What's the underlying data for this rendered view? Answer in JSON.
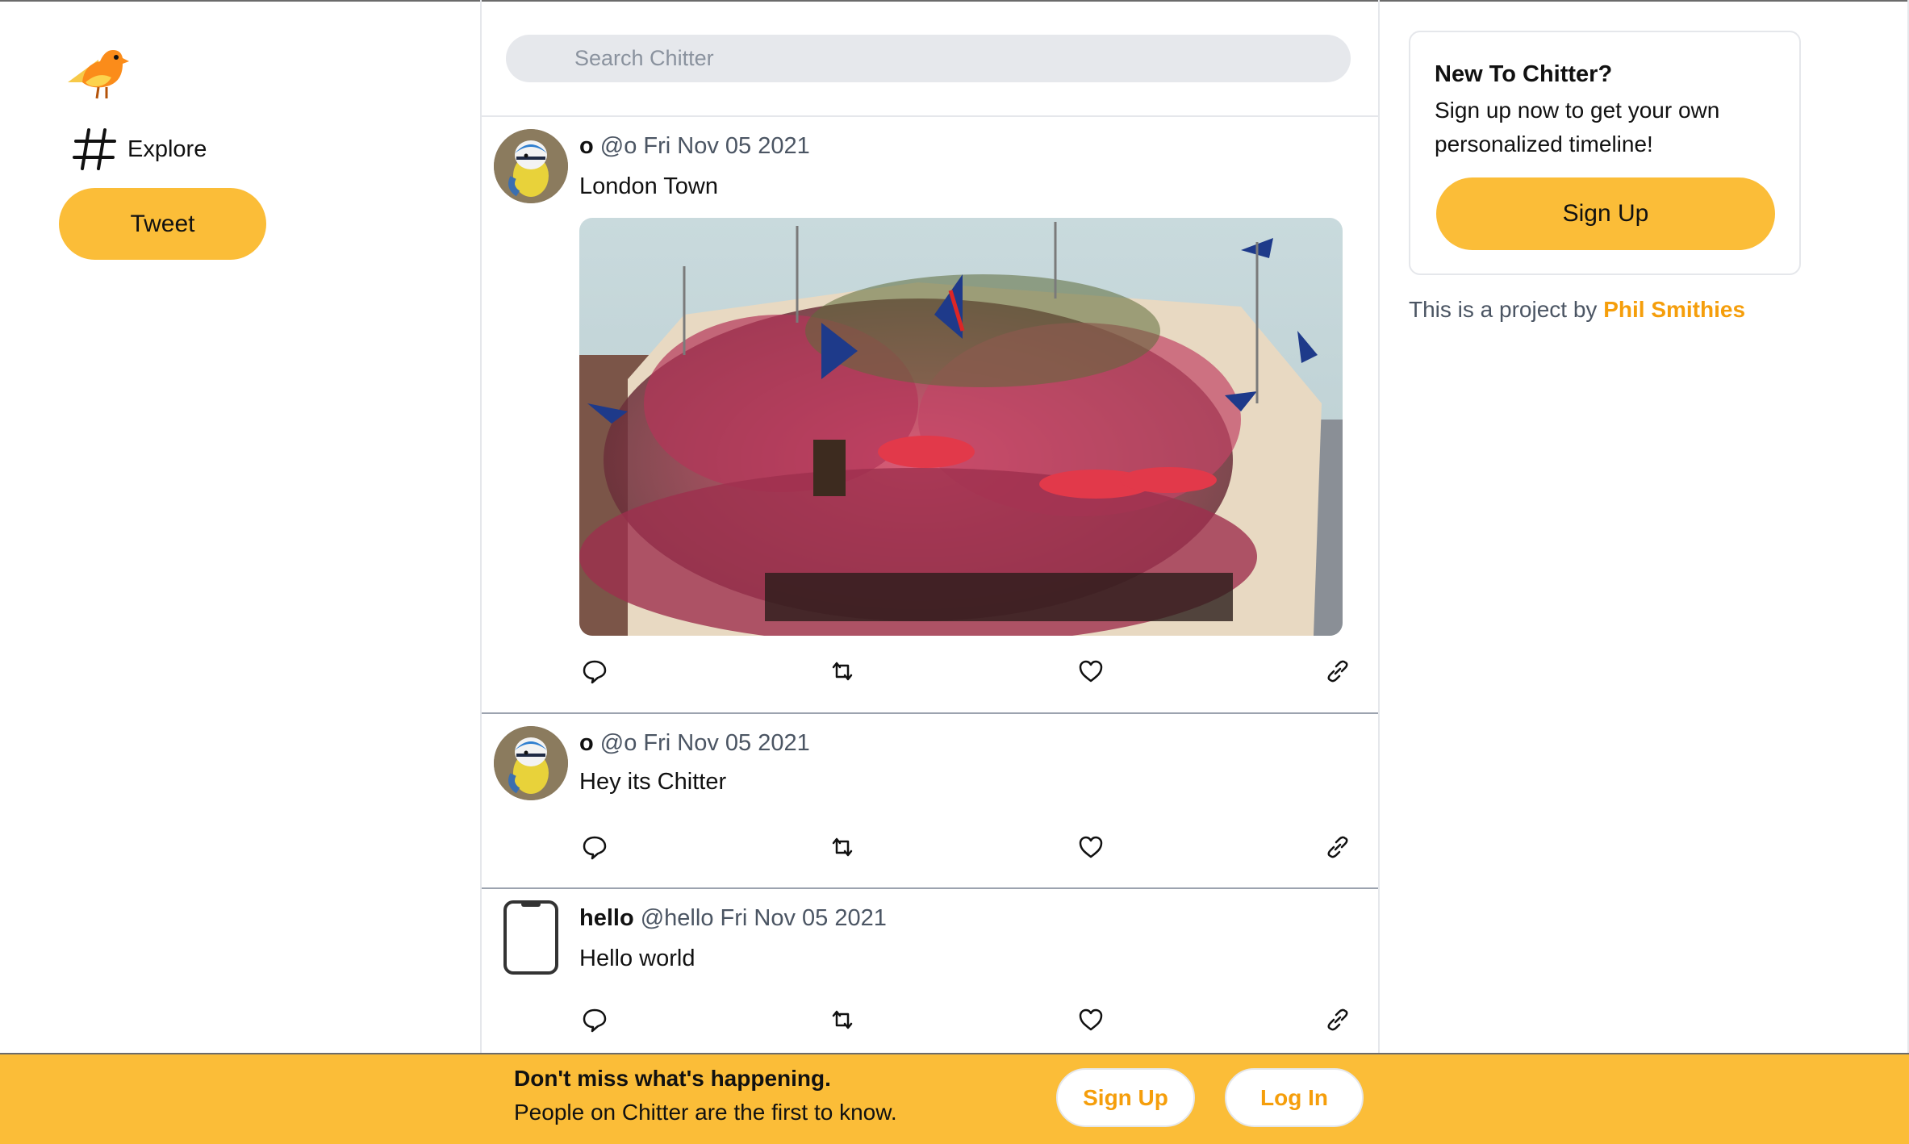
{
  "app": {
    "name": "Chitter"
  },
  "sidebar": {
    "logo_icon": "bird-logo-icon",
    "explore_label": "Explore",
    "explore_icon": "hash-icon",
    "tweet_label": "Tweet"
  },
  "search": {
    "placeholder": "Search Chitter",
    "value": ""
  },
  "feed": {
    "posts": [
      {
        "name": "o",
        "handle": "@o",
        "date": "Fri Nov 05 2021",
        "text": "London Town",
        "avatar": "blue-tit-bird-avatar",
        "media": "flower-covered-london-pub-photo"
      },
      {
        "name": "o",
        "handle": "@o",
        "date": "Fri Nov 05 2021",
        "text": "Hey its Chitter",
        "avatar": "blue-tit-bird-avatar"
      },
      {
        "name": "hello",
        "handle": "@hello",
        "date": "Fri Nov 05 2021",
        "text": "Hello world",
        "avatar": "phone-outline-avatar"
      }
    ],
    "action_icons": [
      "reply-icon",
      "retweet-icon",
      "like-icon",
      "link-icon"
    ]
  },
  "signup_card": {
    "title": "New To Chitter?",
    "description": "Sign up now to get your own personalized timeline!",
    "button_label": "Sign Up"
  },
  "credit": {
    "prefix": "This is a project by ",
    "author": "Phil Smithies"
  },
  "banner": {
    "title": "Don't miss what's happening.",
    "subtitle": "People on Chitter are the first to know.",
    "signup_label": "Sign Up",
    "login_label": "Log In"
  },
  "colors": {
    "accent": "#fbbd38",
    "link": "#f59e0b",
    "muted": "#4b5563",
    "border": "#e5e7eb"
  }
}
